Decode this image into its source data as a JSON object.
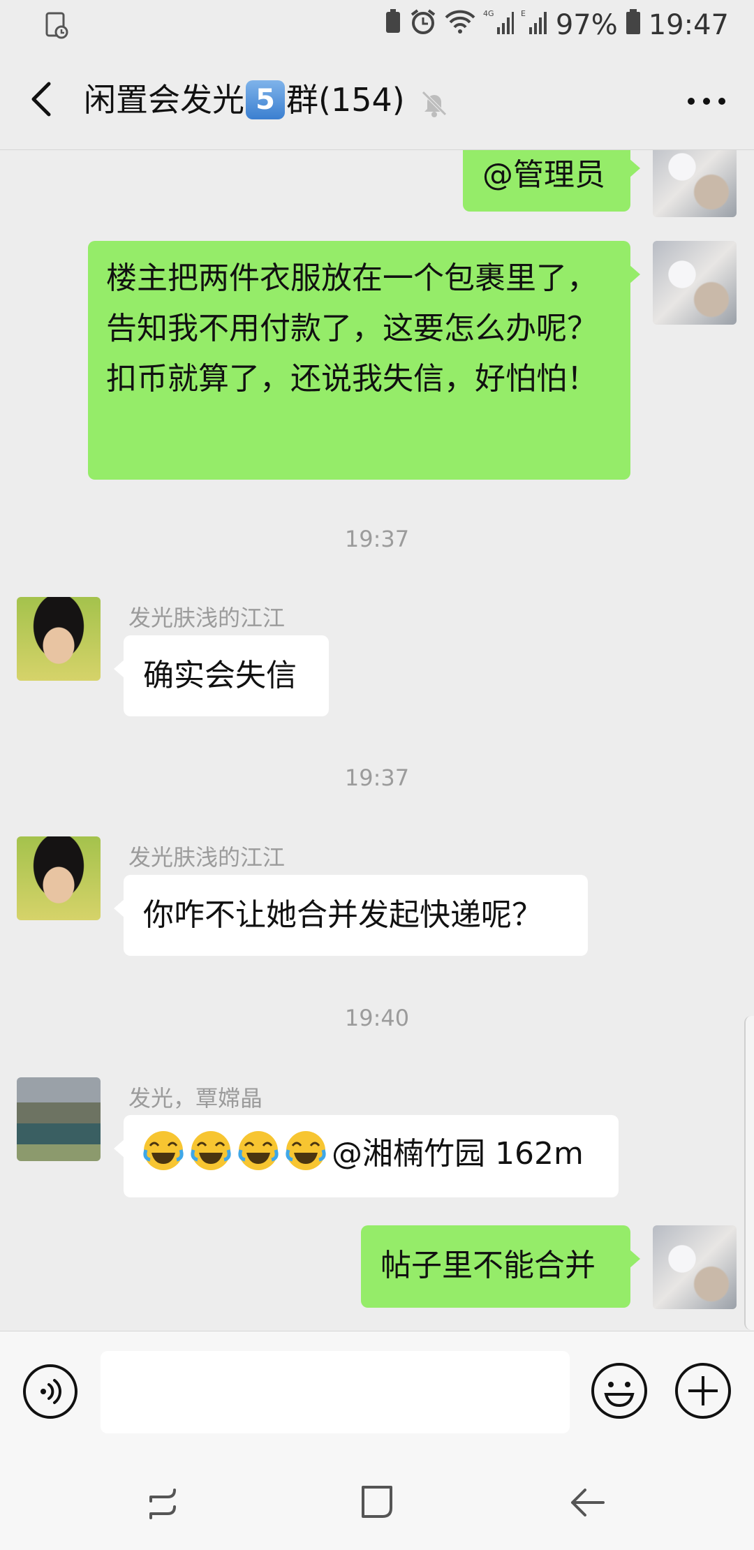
{
  "status_bar": {
    "battery_percent": "97%",
    "time": "19:47",
    "network": "4G"
  },
  "header": {
    "title_prefix": "闲置会发光",
    "title_badge": "5",
    "title_suffix": "群(154)"
  },
  "messages": [
    {
      "from": "me",
      "text": "@管理员"
    },
    {
      "from": "me",
      "text": "楼主把两件衣服放在一个包裹里了，告知我不用付款了，这要怎么办呢？扣币就算了，还说我失信，好怕怕！"
    },
    {
      "timestamp": "19:37"
    },
    {
      "from": "other",
      "sender": "发光肤浅的江江",
      "text": "确实会失信"
    },
    {
      "timestamp": "19:37"
    },
    {
      "from": "other",
      "sender": "发光肤浅的江江",
      "text": "你咋不让她合并发起快递呢？"
    },
    {
      "timestamp": "19:40"
    },
    {
      "from": "other",
      "sender": "发光，覃嫦晶",
      "text": "@湘楠竹园 162m",
      "emoji_prefix_count": 4
    },
    {
      "from": "me",
      "text": "帖子里不能合并"
    }
  ],
  "input_bar": {
    "text": ""
  },
  "icons": [
    "back-arrow-icon",
    "mute-bell-icon",
    "more-dots-icon",
    "voice-icon",
    "emoji-icon",
    "plus-icon",
    "recent-apps-icon",
    "home-icon",
    "back-nav-icon"
  ]
}
